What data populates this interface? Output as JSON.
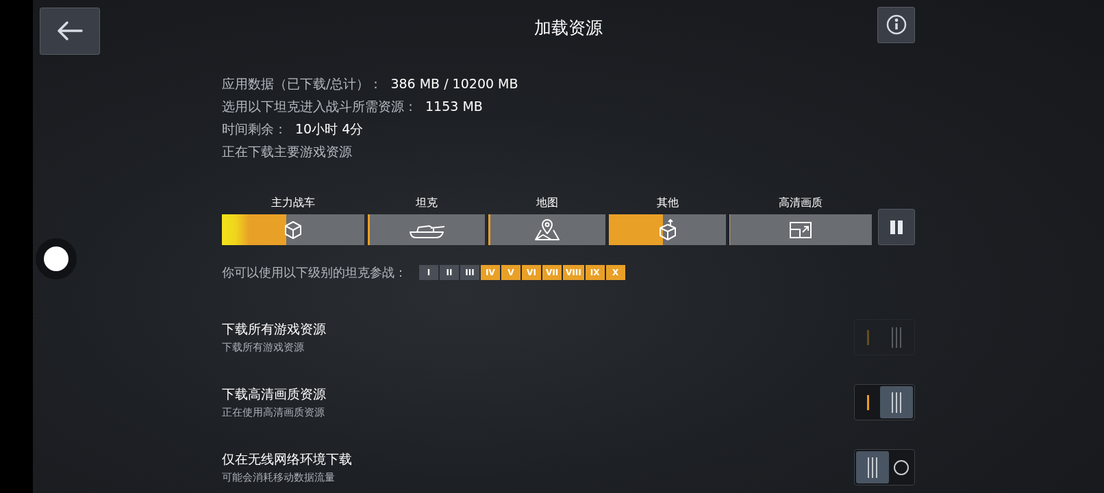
{
  "header": {
    "title": "加载资源"
  },
  "info": [
    {
      "label": "应用数据（已下载/总计）：",
      "value": "386 MB / 10200 MB"
    },
    {
      "label": "选用以下坦克进入战斗所需资源：",
      "value": "1153 MB"
    },
    {
      "label": "时间剩余：",
      "value": "10小时 4分"
    },
    {
      "label": "正在下载主要游戏资源"
    }
  ],
  "categories": [
    {
      "label": "主力战车",
      "kind": "cube",
      "level": 0.45
    },
    {
      "label": "坦克",
      "kind": "tank",
      "level": 0.015
    },
    {
      "label": "地图",
      "kind": "map",
      "level": 0.015
    },
    {
      "label": "其他",
      "kind": "export",
      "level": 0.46
    },
    {
      "label": "高清画质",
      "kind": "hd",
      "level": 0
    }
  ],
  "tiers": {
    "label": "你可以使用以下级别的坦克参战：",
    "items": [
      {
        "label": "I",
        "available": false
      },
      {
        "label": "II",
        "available": false
      },
      {
        "label": "III",
        "available": false
      },
      {
        "label": "IV",
        "available": true
      },
      {
        "label": "V",
        "available": true
      },
      {
        "label": "VI",
        "available": true
      },
      {
        "label": "VII",
        "available": true
      },
      {
        "label": "VIII",
        "available": true
      },
      {
        "label": "IX",
        "available": true
      },
      {
        "label": "X",
        "available": true
      }
    ]
  },
  "toggles": [
    {
      "title": "下载所有游戏资源",
      "subtitle": "下载所有游戏资源",
      "on": true,
      "disabled": true
    },
    {
      "title": "下载高清画质资源",
      "subtitle": "正在使用高清画质资源",
      "on": true,
      "disabled": false
    },
    {
      "title": "仅在无线网络环境下载",
      "subtitle": "可能会消耗移动数据流量",
      "on": false,
      "disabled": false
    }
  ]
}
